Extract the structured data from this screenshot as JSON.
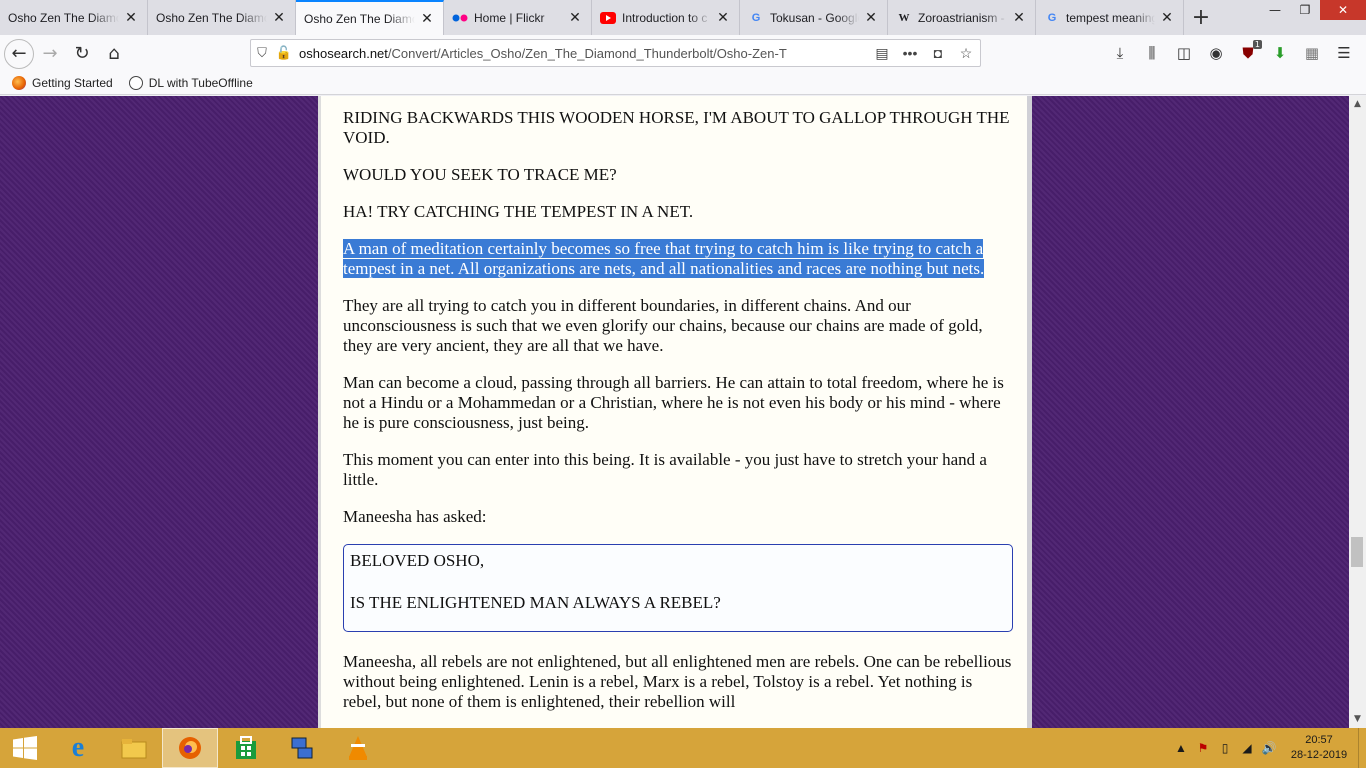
{
  "tabs": [
    {
      "title": "Osho Zen The Diamond",
      "icon": "none",
      "active": false
    },
    {
      "title": "Osho Zen The Diamond",
      "icon": "none",
      "active": false
    },
    {
      "title": "Osho Zen The Diamond",
      "icon": "none",
      "active": true
    },
    {
      "title": "Home | Flickr",
      "icon": "flickr-icon",
      "active": false
    },
    {
      "title": "Introduction to c",
      "icon": "youtube-icon",
      "active": false
    },
    {
      "title": "Tokusan - Google",
      "icon": "google-icon",
      "active": false
    },
    {
      "title": "Zoroastrianism -",
      "icon": "wikipedia-icon",
      "active": false
    },
    {
      "title": "tempest meaning",
      "icon": "google-icon",
      "active": false
    }
  ],
  "url": {
    "domain": "oshosearch.net",
    "path": "/Convert/Articles_Osho/Zen_The_Diamond_Thunderbolt/Osho-Zen-T"
  },
  "bookmarks": [
    {
      "label": "Getting Started",
      "icon": "firefox-icon"
    },
    {
      "label": "DL with TubeOffline",
      "icon": "globe-icon"
    }
  ],
  "toolbar": {
    "ublock_badge": "1"
  },
  "article": {
    "p1": "RIDING BACKWARDS THIS WOODEN HORSE, I'M ABOUT TO GALLOP THROUGH THE VOID.",
    "p2": "WOULD YOU SEEK TO TRACE ME?",
    "p3": "HA! TRY CATCHING THE TEMPEST IN A NET.",
    "p4_selected": "A man of meditation certainly becomes so free that trying to catch him is like trying to catch a tempest in a net. All organizations are nets, and all nationalities and races are nothing but nets.",
    "p5": "They are all trying to catch you in different boundaries, in different chains. And our unconsciousness is such that we even glorify our chains, because our chains are made of gold, they are very ancient, they are all that we have.",
    "p6": "Man can become a cloud, passing through all barriers. He can attain to total freedom, where he is not a Hindu or a Mohammedan or a Christian, where he is not even his body or his mind - where he is pure consciousness, just being.",
    "p7": "This moment you can enter into this being. It is available - you just have to stretch your hand a little.",
    "p8": "Maneesha has asked:",
    "question_line1": "BELOVED OSHO,",
    "question_line2": "IS THE ENLIGHTENED MAN ALWAYS A REBEL?",
    "p9": "Maneesha, all rebels are not enlightened, but all enlightened men are rebels. One can be rebellious without being enlightened. Lenin is a rebel, Marx is a rebel, Tolstoy is a rebel. Yet nothing is rebel, but none of them is enlightened, their rebellion will"
  },
  "taskbar": {
    "time": "20:57",
    "date": "28-12-2019"
  },
  "colors": {
    "page_background": "#4b1f6f",
    "content_background": "#fffef7",
    "selection": "#3a7bd5",
    "taskbar": "#d6a43a",
    "active_tab_accent": "#0a84ff"
  }
}
